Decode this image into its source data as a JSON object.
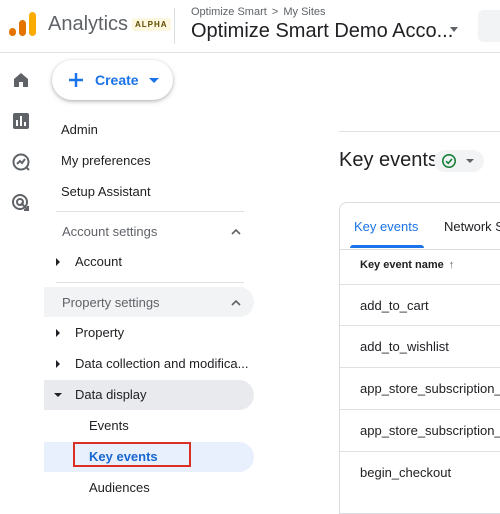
{
  "header": {
    "app_title": "Analytics",
    "badge": "ALPHA",
    "breadcrumb_org": "Optimize Smart",
    "breadcrumb_sep": ">",
    "breadcrumb_sites": "My Sites",
    "account_name": "Optimize Smart Demo Acco..."
  },
  "rail": {
    "icons": [
      "home-icon",
      "reports-icon",
      "explore-icon",
      "advertising-icon"
    ]
  },
  "create_button": {
    "label": "Create"
  },
  "nav": {
    "admin": "Admin",
    "preferences": "My preferences",
    "setup": "Setup Assistant",
    "account_settings": {
      "label": "Account settings",
      "items": [
        "Account"
      ]
    },
    "property_settings": {
      "label": "Property settings",
      "items": [
        "Property",
        "Data collection and modifica...",
        "Data display"
      ]
    },
    "data_display_items": [
      "Events",
      "Key events",
      "Audiences"
    ],
    "selected": "Key events"
  },
  "main": {
    "page_title": "Key events",
    "tabs": [
      "Key events",
      "Network S"
    ],
    "column_header": "Key event name",
    "sort_icon": "↑",
    "rows": [
      "add_to_cart",
      "add_to_wishlist",
      "app_store_subscription_c",
      "app_store_subscription_re",
      "begin_checkout"
    ]
  },
  "colors": {
    "accent": "#1a73e8",
    "highlight_border": "#d93025",
    "success": "#188038"
  }
}
